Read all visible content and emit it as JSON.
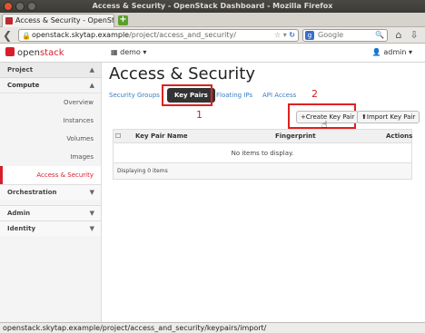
{
  "window": {
    "title": "Access & Security - OpenStack Dashboard - Mozilla Firefox"
  },
  "browser": {
    "tab_title": "Access & Security - OpenStack ...",
    "new_tab": "+",
    "url_host": "openstack.skytap.example",
    "url_path": "/project/access_and_security/",
    "search_placeholder": "Google",
    "search_engine_letter": "g"
  },
  "header": {
    "logo_prefix": "open",
    "logo_suffix": "stack",
    "project_selector": "demo",
    "user_menu": "admin"
  },
  "sidebar": {
    "project_label": "Project",
    "compute_label": "Compute",
    "items": [
      {
        "label": "Overview"
      },
      {
        "label": "Instances"
      },
      {
        "label": "Volumes"
      },
      {
        "label": "Images"
      },
      {
        "label": "Access & Security"
      }
    ],
    "orchestration_label": "Orchestration",
    "admin_label": "Admin",
    "identity_label": "Identity"
  },
  "main": {
    "title": "Access & Security",
    "tabs": [
      {
        "label": "Security Groups"
      },
      {
        "label": "Key Pairs"
      },
      {
        "label": "Floating IPs"
      },
      {
        "label": "API Access"
      }
    ],
    "create_button": "Create Key Pair",
    "import_button": "Import Key Pair",
    "table": {
      "columns": [
        "Key Pair Name",
        "Fingerprint",
        "Actions"
      ],
      "empty_message": "No items to display.",
      "footer": "Displaying 0 items"
    }
  },
  "annotations": {
    "step1": "1",
    "step2": "2",
    "color": "#e02020"
  },
  "statusbar": {
    "text": "openstack.skytap.example/project/access_and_security/keypairs/import/"
  }
}
